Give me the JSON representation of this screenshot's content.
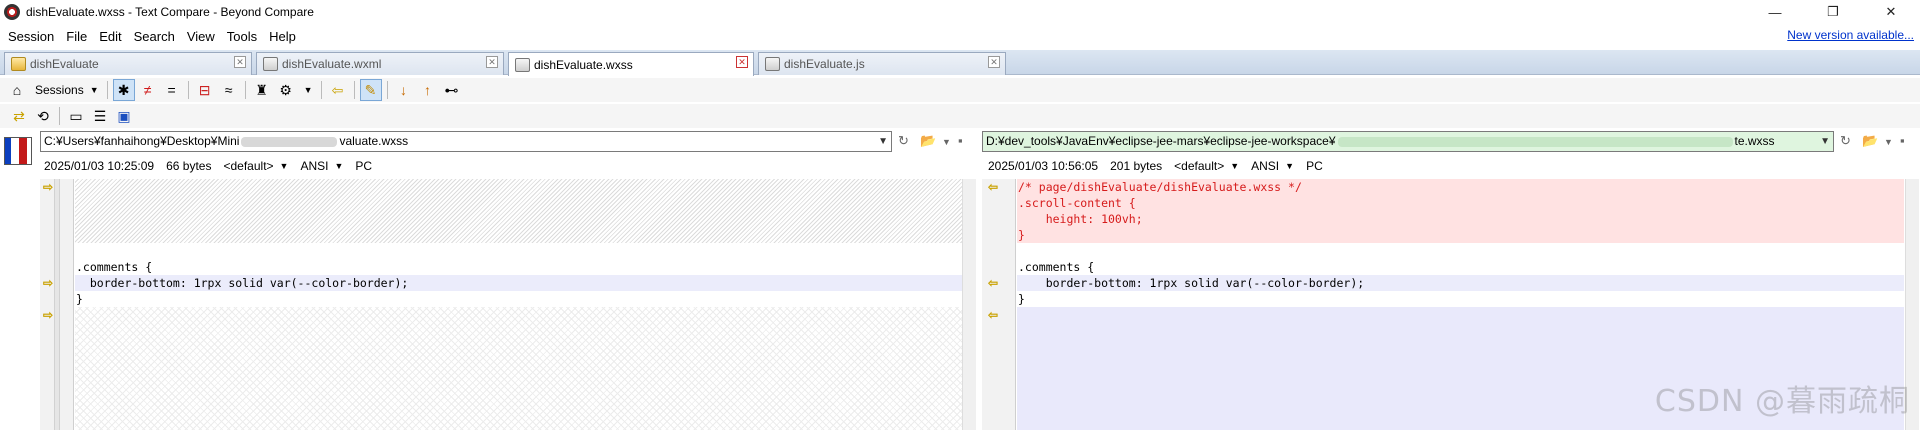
{
  "window": {
    "title": "dishEvaluate.wxss - Text Compare - Beyond Compare",
    "controls": [
      "—",
      "❐",
      "✕"
    ]
  },
  "menu": {
    "items": [
      "Session",
      "File",
      "Edit",
      "Search",
      "View",
      "Tools",
      "Help"
    ],
    "new_version": "New version available..."
  },
  "tabs": [
    {
      "label": "dishEvaluate",
      "icon": "folder-compare-icon",
      "active": false
    },
    {
      "label": "dishEvaluate.wxml",
      "icon": "text-compare-icon",
      "active": false
    },
    {
      "label": "dishEvaluate.wxss",
      "icon": "text-compare-icon",
      "active": true
    },
    {
      "label": "dishEvaluate.js",
      "icon": "text-compare-icon",
      "active": false
    }
  ],
  "toolbar": {
    "sessions_label": "Sessions"
  },
  "left": {
    "path": "C:¥Users¥fanhaihong¥Desktop¥Mini",
    "path_tail": "valuate.wxss",
    "timestamp": "2025/01/03 10:25:09",
    "size": "66 bytes",
    "format": "<default>",
    "encoding": "ANSI",
    "line_ending": "PC",
    "lines": [
      "",
      "",
      "",
      "",
      "",
      ".comments {",
      "  border-bottom: 1rpx solid var(--color-border);",
      "}"
    ]
  },
  "right": {
    "path": "D:¥dev_tools¥JavaEnv¥eclipse-jee-mars¥eclipse-jee-workspace¥",
    "path_tail": "te.wxss",
    "timestamp": "2025/01/03 10:56:05",
    "size": "201 bytes",
    "format": "<default>",
    "encoding": "ANSI",
    "line_ending": "PC",
    "lines": [
      "/* page/dishEvaluate/dishEvaluate.wxss */",
      ".scroll-content {",
      "    height: 100vh;",
      "}",
      "",
      ".comments {",
      "    border-bottom: 1rpx solid var(--color-border);",
      "}"
    ]
  },
  "watermark": "CSDN @暮雨疏桐",
  "colors": {
    "diff_red_bg": "#ffe2e2",
    "diff_red_text": "#d61b1b",
    "diff_blue_bg": "#ebecfb",
    "arrow": "#c9a200"
  }
}
